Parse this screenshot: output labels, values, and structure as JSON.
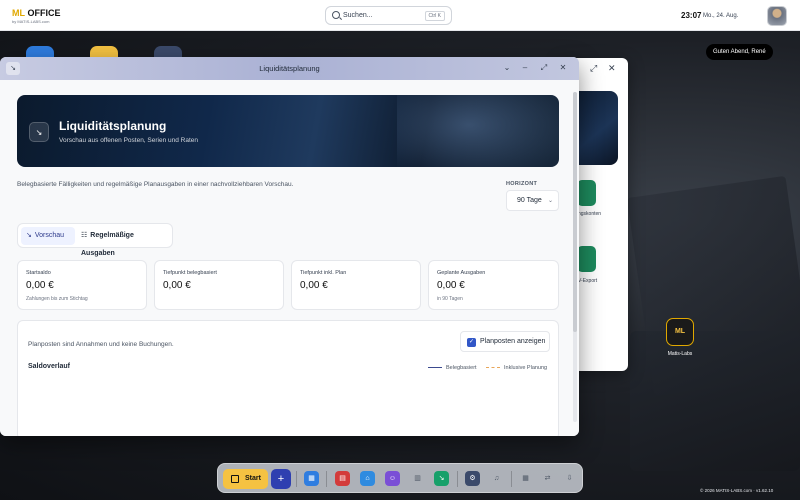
{
  "topbar": {
    "logo_main": "ML",
    "logo_rest": " OFFICE",
    "logo_sub": "by MATIS-LABS.com",
    "search_placeholder": "Suchen...",
    "search_shortcut": "Ctrl K",
    "time": "23:07",
    "date": "Mo., 24. Aug."
  },
  "desktop": {
    "greeting": "Guten Abend, René",
    "icons": [
      {
        "label": "Matis-Labs",
        "glyph": "ML"
      }
    ],
    "back_window": {
      "label1": "ngskonten",
      "label2": "V-Export"
    },
    "footer": "© 2026 MATIS-LABS.com · v1.62.10"
  },
  "window": {
    "title": "Liquiditätsplanung",
    "hero": {
      "title": "Liquiditätsplanung",
      "subtitle": "Vorschau aus offenen Posten, Serien und Raten"
    },
    "description": "Belegbasierte Fälligkeiten und regelmäßige Planausgaben in einer nachvollziehbaren Vorschau.",
    "horizon": {
      "label": "HORIZONT",
      "value": "90 Tage"
    },
    "tabs": [
      {
        "label": "Vorschau",
        "active": true
      },
      {
        "label": "Regelmäßige Ausgaben",
        "active": false
      }
    ],
    "cards": [
      {
        "label": "Startsaldo",
        "value": "0,00 €",
        "sub": "Zahlungen bis zum Stichtag"
      },
      {
        "label": "Tiefpunkt belegbasiert",
        "value": "0,00 €",
        "sub": ""
      },
      {
        "label": "Tiefpunkt inkl. Plan",
        "value": "0,00 €",
        "sub": ""
      },
      {
        "label": "Geplante Ausgaben",
        "value": "0,00 €",
        "sub": "in 90 Tagen"
      }
    ],
    "panel": {
      "text": "Planposten sind Annahmen und keine Buchungen.",
      "checkbox_label": "Planposten anzeigen",
      "checkbox_checked": true,
      "chart_title": "Saldoverlauf",
      "legend": [
        {
          "label": "Belegbasiert",
          "color": "#3b4a8f",
          "style": "solid"
        },
        {
          "label": "Inklusive Planung",
          "color": "#e8a65a",
          "style": "dashed"
        }
      ]
    }
  },
  "dock": {
    "start_label": "Start",
    "items": [
      {
        "name": "calendar-icon",
        "color": "#2f7de0",
        "glyph": "▦"
      },
      {
        "name": "pdf-icon",
        "color": "#d33b3b",
        "glyph": "▤"
      },
      {
        "name": "home-icon",
        "color": "#2f8be0",
        "glyph": "⌂"
      },
      {
        "name": "people-icon",
        "color": "#7a4fd6",
        "glyph": "☺"
      },
      {
        "name": "trash-icon",
        "color": "transparent",
        "glyph": "🗑"
      },
      {
        "name": "liquidity-icon",
        "color": "#17a06a",
        "glyph": "↘"
      },
      {
        "name": "settings-icon",
        "color": "#3b4a6b",
        "glyph": "⚙"
      },
      {
        "name": "bell-icon",
        "color": "transparent",
        "glyph": "🔔"
      },
      {
        "name": "grid-icon",
        "color": "transparent",
        "glyph": "▦"
      },
      {
        "name": "swap-icon",
        "color": "transparent",
        "glyph": "⇄"
      },
      {
        "name": "download-icon",
        "color": "transparent",
        "glyph": "⇩"
      }
    ]
  }
}
